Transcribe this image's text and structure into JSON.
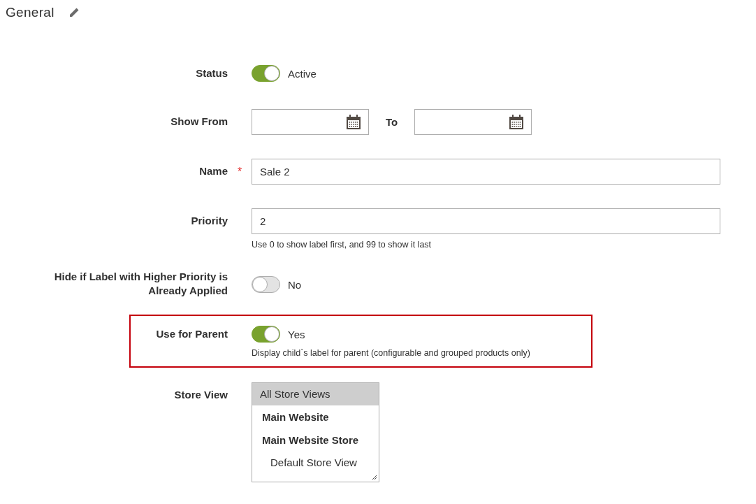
{
  "section": {
    "title": "General"
  },
  "fields": [
    {
      "kind": "toggle",
      "label": "Status",
      "on": true,
      "value": "Active"
    },
    {
      "kind": "daterange",
      "label": "Show From",
      "separator": "To"
    },
    {
      "kind": "text",
      "label": "Name",
      "required_mark": "*",
      "value": "Sale 2"
    },
    {
      "kind": "text",
      "label": "Priority",
      "value": "2",
      "note": "Use 0 to show label first, and 99 to show it last"
    },
    {
      "kind": "toggle",
      "label": "Hide if Label with Higher Priority is Already Applied",
      "on": false,
      "value": "No"
    },
    {
      "kind": "toggle",
      "label": "Use for Parent",
      "on": true,
      "value": "Yes",
      "highlighted": true,
      "note": "Display child`s label for parent (configurable and grouped products only)"
    },
    {
      "kind": "listbox",
      "label": "Store View",
      "options": [
        {
          "kind": "option",
          "label": "All Store Views",
          "selected": true
        },
        {
          "kind": "group",
          "label": "Main Website"
        },
        {
          "kind": "group",
          "label": "Main Website Store",
          "children": [
            {
              "kind": "option",
              "label": "Default Store View",
              "selected": false
            }
          ]
        }
      ]
    }
  ]
}
